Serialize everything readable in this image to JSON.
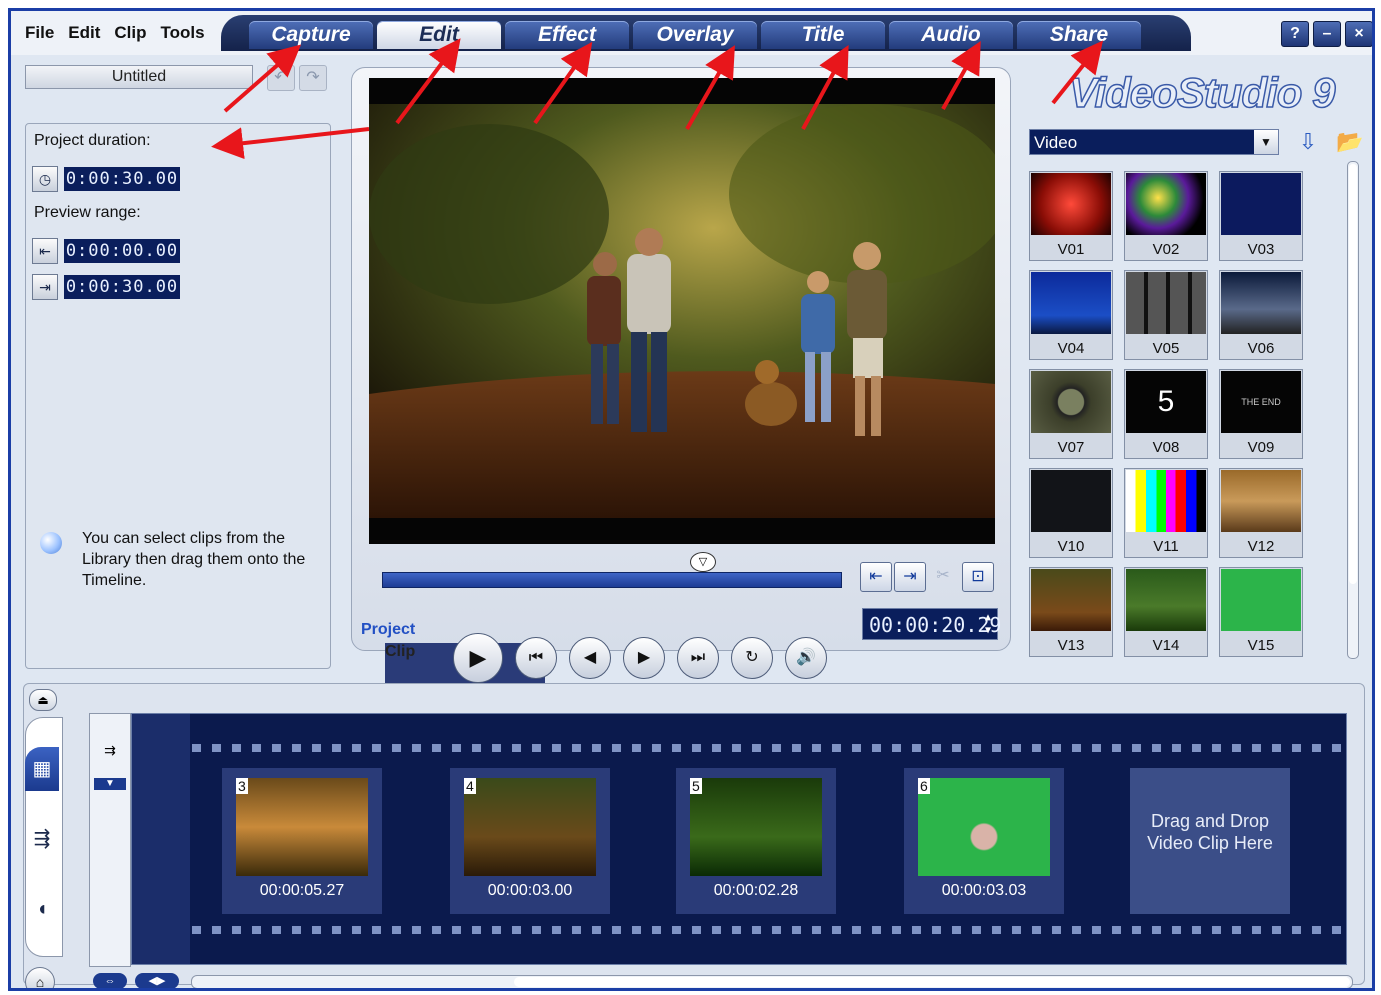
{
  "menu": [
    "File",
    "Edit",
    "Clip",
    "Tools"
  ],
  "tabs": [
    {
      "label": "Capture",
      "active": false
    },
    {
      "label": "Edit",
      "active": true
    },
    {
      "label": "Effect",
      "active": false
    },
    {
      "label": "Overlay",
      "active": false
    },
    {
      "label": "Title",
      "active": false
    },
    {
      "label": "Audio",
      "active": false
    },
    {
      "label": "Share",
      "active": false
    }
  ],
  "window": {
    "help": "?",
    "minimize": "–",
    "close": "×"
  },
  "project": {
    "title": "Untitled",
    "duration_label": "Project duration:",
    "duration": "0:00:30.00",
    "range_label": "Preview range:",
    "range_start": "0:00:00.00",
    "range_end": "0:00:30.00",
    "tip": "You can select clips from the Library then drag them onto the Timeline."
  },
  "preview": {
    "timecode": "00:00:20.29",
    "mode_project": "Project",
    "mode_clip": "Clip"
  },
  "library": {
    "logo": "VideoStudio 9",
    "selected": "Video",
    "items": [
      "V01",
      "V02",
      "V03",
      "V04",
      "V05",
      "V06",
      "V07",
      "V08",
      "V09",
      "V10",
      "V11",
      "V12",
      "V13",
      "V14",
      "V15"
    ]
  },
  "timeline": {
    "clips": [
      {
        "num": "3",
        "duration": "00:00:05.27"
      },
      {
        "num": "4",
        "duration": "00:00:03.00"
      },
      {
        "num": "5",
        "duration": "00:00:02.28"
      },
      {
        "num": "6",
        "duration": "00:00:03.03"
      }
    ],
    "dropzone": "Drag and Drop Video Clip Here"
  },
  "colors": {
    "accent": "#1b3ea6",
    "timecode_bg": "#0a1e5c",
    "annotation": "#e8161b"
  }
}
